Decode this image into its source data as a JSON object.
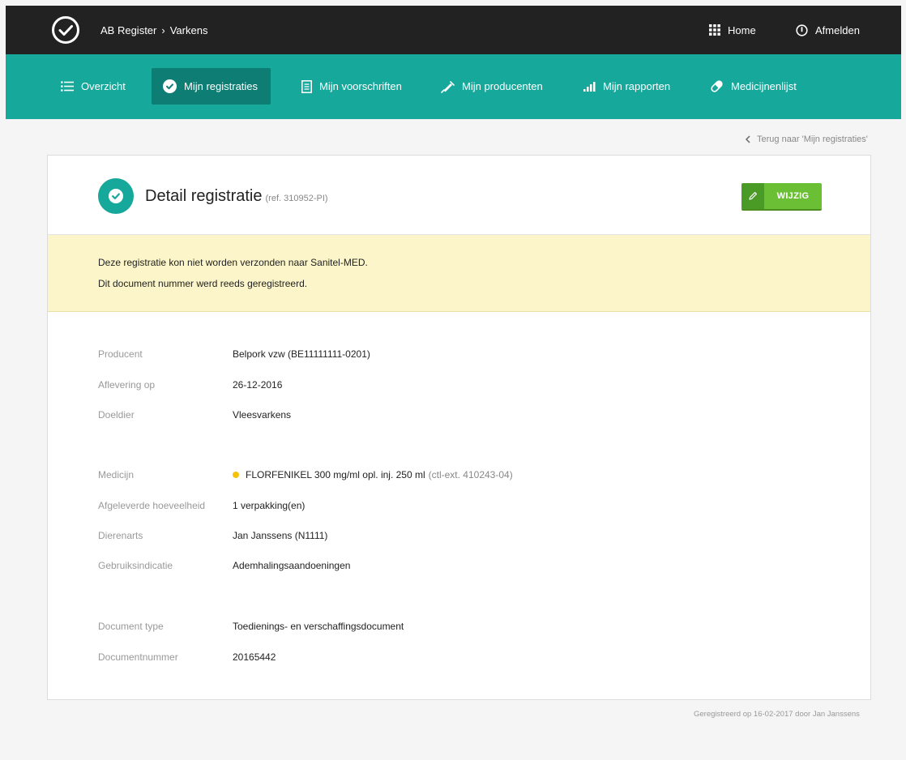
{
  "topbar": {
    "app": "AB Register",
    "section": "Varkens",
    "home_label": "Home",
    "logout_label": "Afmelden"
  },
  "nav": {
    "items": [
      {
        "label": "Overzicht",
        "icon": "list-icon"
      },
      {
        "label": "Mijn registraties",
        "icon": "check-circle-icon",
        "active": true
      },
      {
        "label": "Mijn voorschriften",
        "icon": "document-icon"
      },
      {
        "label": "Mijn producenten",
        "icon": "syringe-icon"
      },
      {
        "label": "Mijn rapporten",
        "icon": "bar-chart-icon"
      },
      {
        "label": "Medicijnenlijst",
        "icon": "pill-icon"
      }
    ]
  },
  "back_link": "Terug naar 'Mijn registraties'",
  "detail": {
    "title": "Detail registratie",
    "ref": "(ref. 310952-PI)",
    "edit_label": "WIJZIG"
  },
  "warning": {
    "line1": "Deze registratie kon niet worden verzonden naar Sanitel-MED.",
    "line2": "Dit document nummer werd reeds geregistreerd."
  },
  "fields": {
    "producent": {
      "label": "Producent",
      "value": "Belpork vzw (BE11111111-0201)"
    },
    "aflevering": {
      "label": "Aflevering op",
      "value": "26-12-2016"
    },
    "doeldier": {
      "label": "Doeldier",
      "value": "Vleesvarkens"
    },
    "medicijn": {
      "label": "Medicijn",
      "value": "FLORFENIKEL 300 mg/ml opl. inj. 250 ml",
      "extra": "(ctl-ext. 410243-04)",
      "status_color": "#f4c20d"
    },
    "hoeveelheid": {
      "label": "Afgeleverde hoeveelheid",
      "value": "1 verpakking(en)"
    },
    "dierenarts": {
      "label": "Dierenarts",
      "value": "Jan Janssens (N1111)"
    },
    "indicatie": {
      "label": "Gebruiksindicatie",
      "value": "Ademhalingsaandoeningen"
    },
    "doctype": {
      "label": "Document type",
      "value": "Toedienings- en verschaffingsdocument"
    },
    "docnr": {
      "label": "Documentnummer",
      "value": "20165442"
    }
  },
  "footer_note": "Geregistreerd op 16-02-2017 door Jan Janssens",
  "colors": {
    "topbar": "#222222",
    "nav": "#16a89a",
    "nav_active": "#0e7e74",
    "warning_bg": "#fbf5c9",
    "edit_button": "#6bbf34"
  }
}
